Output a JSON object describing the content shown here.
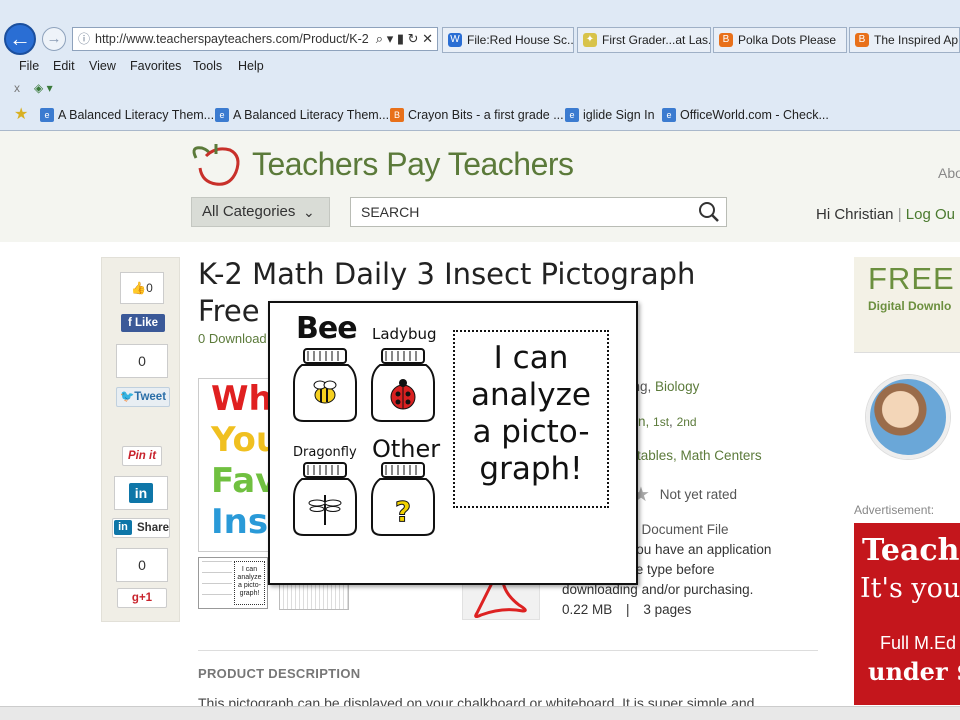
{
  "browser": {
    "url": "http://www.teacherspayteachers.com/Product/K-2",
    "tabs": [
      {
        "title": "File:Red House Sc..."
      },
      {
        "title": "First Grader...at Las..."
      },
      {
        "title": "Polka Dots Please"
      },
      {
        "title": "The Inspired Ap"
      }
    ],
    "menu": [
      "File",
      "Edit",
      "View",
      "Favorites",
      "Tools",
      "Help"
    ],
    "favorites": [
      {
        "title": "A Balanced Literacy Them..."
      },
      {
        "title": "A Balanced Literacy Them..."
      },
      {
        "title": "Crayon Bits - a first grade ..."
      },
      {
        "title": "iglide Sign In"
      },
      {
        "title": "OfficeWorld.com - Check..."
      }
    ]
  },
  "site": {
    "logo": "Teachers Pay Teachers",
    "about": "Abo",
    "categories": "All Categories",
    "search_placeholder": "SEARCH",
    "greeting": "Hi Christian",
    "login": "Log Ou"
  },
  "social": {
    "like_count": "0",
    "like_label": "Like",
    "tweet_count": "0",
    "tweet_label": "Tweet",
    "pin_label": "Pin it",
    "share_label": "Share",
    "gplus_count": "0",
    "gplus_label": "+1"
  },
  "product": {
    "title_line1": "K-2 Math Daily 3 Insect Pictograph",
    "title_line2": "Free",
    "downloads": "0 Download",
    "subjects_suffix": "ning,",
    "subject_link": "Biology",
    "grades_prefix": "n,",
    "grade1": "1st",
    "grade2": "2nd",
    "types_suffix": "rintables,",
    "type_link": "Math Centers",
    "rating": "Not yet rated",
    "file_type": "at) Document File",
    "file_note1": "t you have an application",
    "file_note2": "file type before",
    "file_note3": "downloading and/or purchasing.",
    "file_size": "0.22 MB",
    "pages": "3 pages",
    "main_image_lines": [
      "Wh",
      "You",
      "Fav",
      "Ins"
    ],
    "description_heading": "PRODUCT DESCRIPTION",
    "description_text": "This pictograph can be displayed on your chalkboard or whiteboard. It is super simple and"
  },
  "popup": {
    "jars": [
      "Bee",
      "Ladybug",
      "Dragonfly",
      "Other"
    ],
    "statement": [
      "I can",
      "analyze",
      "a picto-",
      "graph!"
    ]
  },
  "right": {
    "free_label": "FREE",
    "free_sub": "Digital Downlo",
    "ad_label": "Advertisement:",
    "ad_line1": "Teachi",
    "ad_line2": "It's your",
    "ad_line3": "Full M.Ed",
    "ad_line4": "under $"
  }
}
